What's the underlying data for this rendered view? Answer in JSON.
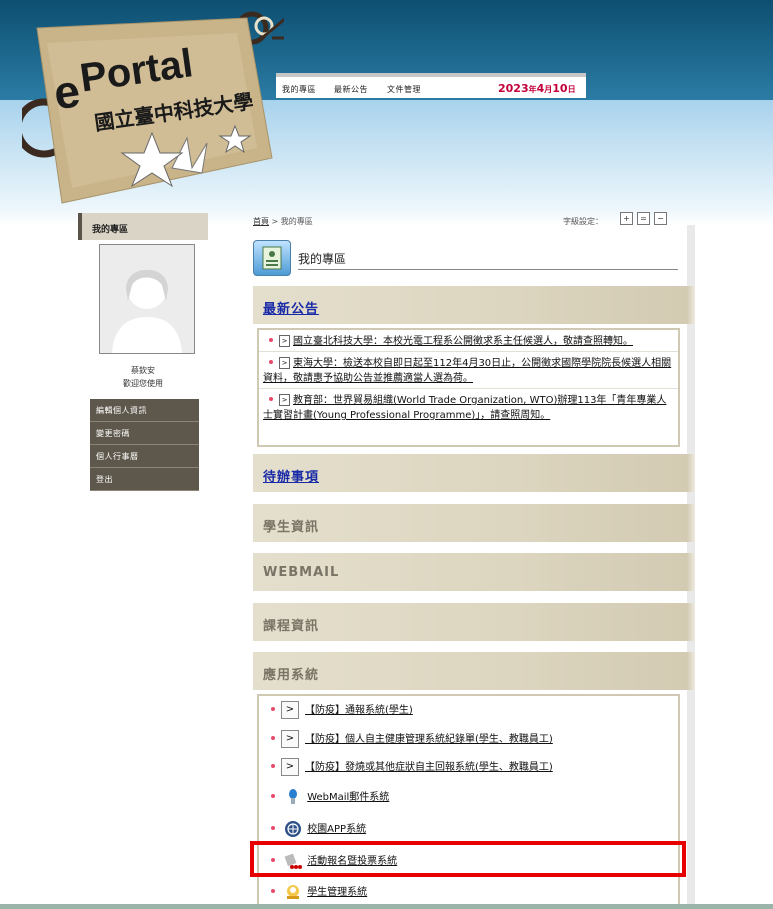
{
  "header": {
    "logo_e": "e",
    "logo_portal": "Portal",
    "logo_school": "國立臺中科技大學"
  },
  "topnav": {
    "items": [
      "我的專區",
      "最新公告",
      "文件管理"
    ],
    "date_year": "2023",
    "date_y_unit": "年",
    "date_month": "4",
    "date_m_unit": "月",
    "date_day": "10",
    "date_d_unit": "日"
  },
  "sidebar": {
    "tab_label": "我的專區",
    "user_name": "蔡欽安",
    "welcome": "歡迎您使用",
    "menu": [
      "編輯個人資訊",
      "變更密碼",
      "個人行事曆",
      "登出"
    ]
  },
  "main": {
    "breadcrumb_home": "首頁",
    "breadcrumb_sep": " > ",
    "breadcrumb_current": "我的專區",
    "font_size_label": "字級設定：",
    "font_buttons": [
      "+",
      "=",
      "−"
    ],
    "page_title": "我的專區",
    "sections": {
      "news": "最新公告",
      "todo": "待辦事項",
      "student": "學生資訊",
      "webmail": "WEBMAIL",
      "course": "課程資訊",
      "apps": "應用系統"
    },
    "news_items": [
      "國立臺北科技大學：本校光電工程系公開徵求系主任候選人，敬請查照轉知。",
      "東海大學：檢送本校自即日起至112年4月30日止，公開徵求國際學院院長候選人相關資料，敬請惠予協助公告並推薦適當人選為荷。",
      "教育部：世界貿易組織(World Trade Organization, WTO)辦理113年「青年專業人士實習計畫(Young Professional Programme)」，請查照周知。"
    ],
    "apps": [
      {
        "label": "【防疫】通報系統(學生)",
        "icon": "arrow-icon"
      },
      {
        "label": "【防疫】個人自主健康管理系統紀錄單(學生、教職員工)",
        "icon": "arrow-icon"
      },
      {
        "label": "【防疫】發燒或其他症狀自主回報系統(學生、教職員工)",
        "icon": "arrow-icon"
      },
      {
        "label": "WebMail郵件系統",
        "icon": "webmail-icon"
      },
      {
        "label": "校園APP系統",
        "icon": "campus-app-icon"
      },
      {
        "label": "活動報名暨投票系統",
        "icon": "vote-icon"
      },
      {
        "label": "學生管理系統",
        "icon": "student-mgmt-icon"
      }
    ]
  },
  "colors": {
    "header_blue": "#0d4f71",
    "menu_bg": "#5e574c",
    "date_red": "#c4003b",
    "link_blue": "#1a2ba8",
    "highlight_red": "#e60000"
  }
}
